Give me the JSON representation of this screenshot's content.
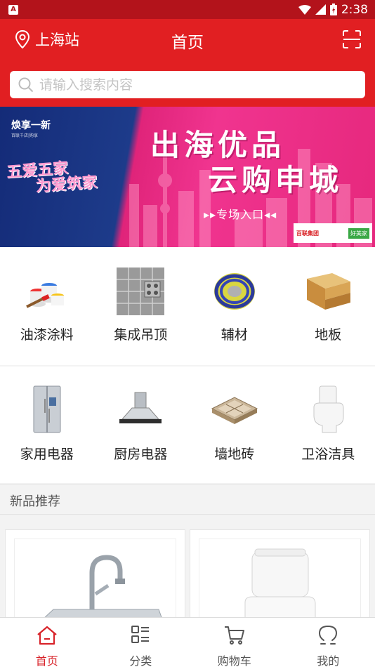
{
  "status_bar": {
    "time": "2:38",
    "app_badge": "A"
  },
  "header": {
    "location": "上海站",
    "title": "首页"
  },
  "search": {
    "placeholder": "请输入搜索内容"
  },
  "banner": {
    "top_brand": "焕享一新",
    "top_brand_sub": "百联千店|购享",
    "left_slogan_1": "五爱五家",
    "left_slogan_2": "为爱筑家",
    "headline_1": "出海优品",
    "headline_2": "云购申城",
    "entry": "▸▸专场入口◂◂",
    "brand_1": "百联集团",
    "brand_2": "好美家"
  },
  "categories_row1": [
    {
      "label": "油漆涂料",
      "icon": "paint-cans-icon"
    },
    {
      "label": "集成吊顶",
      "icon": "ceiling-panel-icon"
    },
    {
      "label": "辅材",
      "icon": "wire-coil-icon"
    },
    {
      "label": "地板",
      "icon": "wood-floor-icon"
    }
  ],
  "categories_row2": [
    {
      "label": "家用电器",
      "icon": "refrigerator-icon"
    },
    {
      "label": "厨房电器",
      "icon": "range-hood-icon"
    },
    {
      "label": "墙地砖",
      "icon": "tile-icon"
    },
    {
      "label": "卫浴洁具",
      "icon": "toilet-icon"
    }
  ],
  "section": {
    "title": "新品推荐"
  },
  "tabbar": [
    {
      "label": "首页",
      "icon": "home-icon",
      "active": true
    },
    {
      "label": "分类",
      "icon": "category-icon",
      "active": false
    },
    {
      "label": "购物车",
      "icon": "cart-icon",
      "active": false
    },
    {
      "label": "我的",
      "icon": "profile-icon",
      "active": false
    }
  ],
  "colors": {
    "primary_red": "#e11f22",
    "status_red": "#b3131b",
    "active_tab": "#d8232a"
  }
}
